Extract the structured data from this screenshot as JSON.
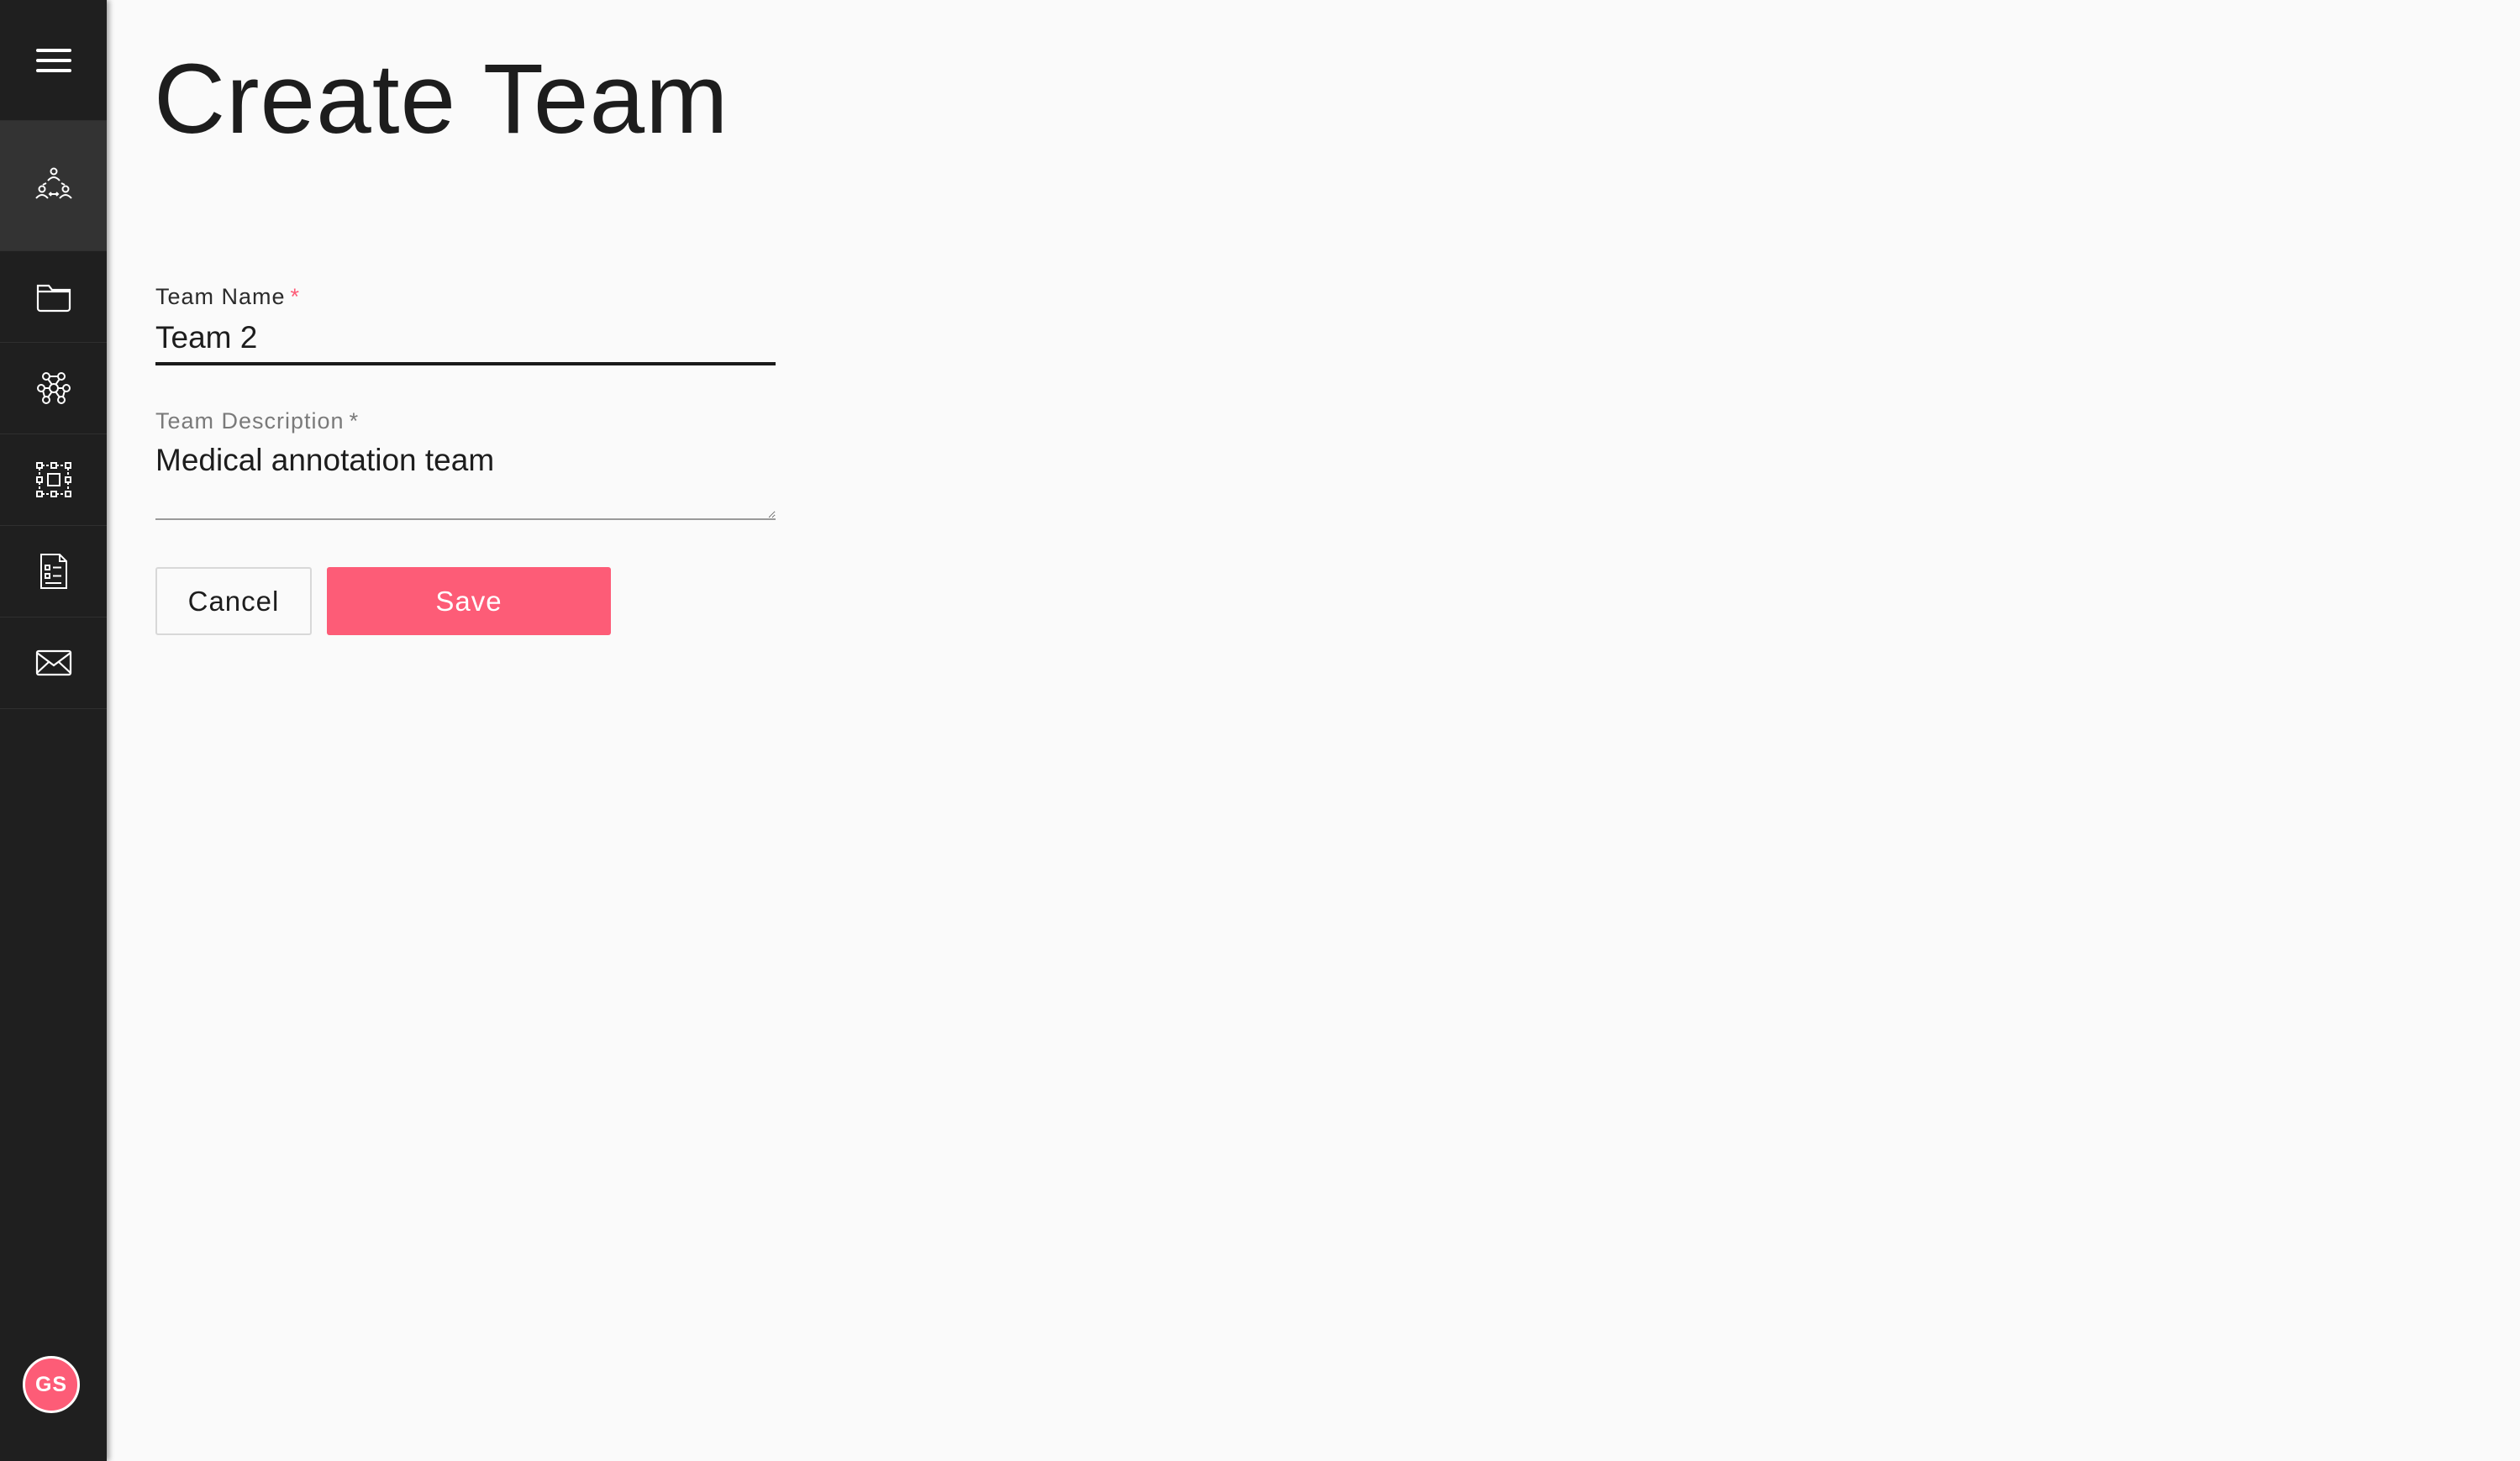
{
  "page": {
    "title": "Create Team"
  },
  "sidebar": {
    "menu_icon": "hamburger-menu-icon",
    "items": [
      {
        "name": "teams",
        "icon": "team-network-icon",
        "active": true
      },
      {
        "name": "projects",
        "icon": "folder-icon",
        "active": false
      },
      {
        "name": "models",
        "icon": "molecule-icon",
        "active": false
      },
      {
        "name": "annotations",
        "icon": "bounding-box-icon",
        "active": false
      },
      {
        "name": "tasks",
        "icon": "checklist-document-icon",
        "active": false
      },
      {
        "name": "messages",
        "icon": "mail-icon",
        "active": false
      }
    ],
    "avatar_initials": "GS"
  },
  "form": {
    "team_name": {
      "label": "Team Name",
      "required_mark": "*",
      "value": "Team 2"
    },
    "team_description": {
      "label": "Team Description",
      "required_mark": "*",
      "value": "Medical annotation team"
    },
    "cancel_label": "Cancel",
    "save_label": "Save"
  },
  "colors": {
    "accent": "#fd5c77",
    "sidebar": "#1f1f1f",
    "background": "#fafafa"
  }
}
